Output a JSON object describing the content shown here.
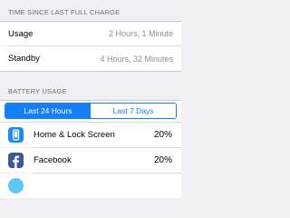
{
  "since_charge": {
    "header": "TIME SINCE LAST FULL CHARGE",
    "rows": [
      {
        "label": "Usage",
        "value": "2 Hours, 1 Minute"
      },
      {
        "label": "Standby",
        "value": "4 Hours, 32 Minutes"
      }
    ]
  },
  "battery_usage": {
    "header": "BATTERY USAGE",
    "tabs": [
      {
        "label": "Last 24 Hours",
        "selected": true
      },
      {
        "label": "Last 7 Days",
        "selected": false
      }
    ],
    "apps": [
      {
        "name": "Home & Lock Screen",
        "percent": "20%",
        "icon": "home-lock-screen-icon",
        "icon_color": "#1a8af8"
      },
      {
        "name": "Facebook",
        "percent": "20%",
        "icon": "facebook-icon",
        "icon_color": "#3b5998"
      },
      {
        "name": "",
        "percent": "",
        "icon": "app-icon-partial",
        "icon_color": "#5ac8fa"
      }
    ]
  },
  "colors": {
    "accent": "#157efb",
    "background": "#efeff4",
    "secondary_text": "#8e8e93"
  }
}
